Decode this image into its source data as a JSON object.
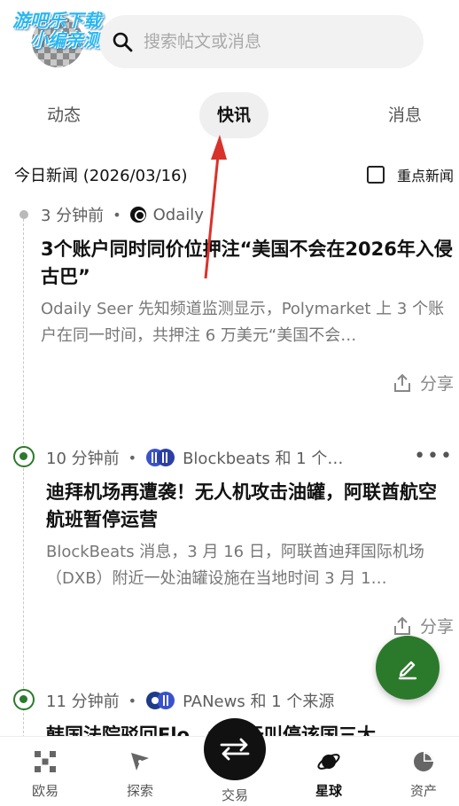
{
  "header": {
    "watermark_line1": "游吧乐下载",
    "watermark_line2": "小编亲测",
    "search_placeholder": "搜索帖文或消息"
  },
  "tabs": [
    {
      "label": "动态"
    },
    {
      "label": "快讯",
      "active": true
    },
    {
      "label": "消息"
    }
  ],
  "filter": {
    "date_title": "今日新闻 (2026/03/16)",
    "key_news_label": "重点新闻",
    "key_news_checked": false
  },
  "feed": [
    {
      "time": "3 分钟前",
      "separator": "•",
      "source": "Odaily",
      "headline": "3个账户同时同价位押注“美国不会在2026年入侵古巴”",
      "summary": "Odaily Seer 先知频道监测显示，Polymarket 上 3 个账户在同一时间，共押注 6 万美元“美国不会…",
      "share_label": "分享"
    },
    {
      "time": "10 分钟前",
      "separator": "•",
      "source": "Blockbeats 和 1 个…",
      "more": "•••",
      "headline": "迪拜机场再遭袭！无人机攻击油罐，阿联酋航空航班暂停运营",
      "summary": "BlockBeats 消息，3 月 16 日，阿联酋迪拜国际机场（DXB）附近一处油罐设施在当地时间 3 月 1…",
      "share_label": "分享"
    },
    {
      "time": "11 分钟前",
      "separator": "•",
      "source": "PANews 和 1 个来源",
      "headline": "韩国法院驳回Flo…会关于叫停该国三大"
    }
  ],
  "bottom_nav": [
    {
      "label": "欧易",
      "icon": "okx-logo-icon"
    },
    {
      "label": "探索",
      "icon": "compass-icon"
    },
    {
      "label": "交易",
      "icon": "swap-arrows-icon"
    },
    {
      "label": "星球",
      "icon": "planet-icon",
      "active": true
    },
    {
      "label": "资产",
      "icon": "pie-chart-icon"
    }
  ],
  "colors": {
    "accent_green": "#2b7a2b",
    "annotation_red": "#d9322b",
    "watermark_blue": "#2ab7f0"
  }
}
